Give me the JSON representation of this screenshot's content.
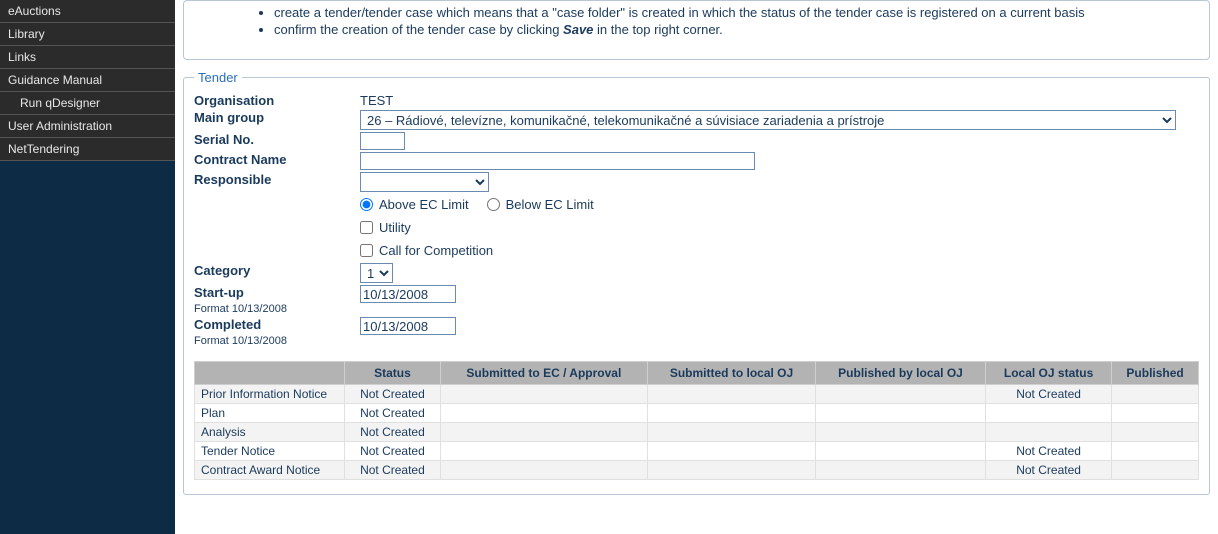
{
  "sidebar": {
    "items": [
      {
        "label": "eAuctions"
      },
      {
        "label": "Library"
      },
      {
        "label": "Links"
      },
      {
        "label": "Guidance Manual"
      },
      {
        "label": "Run qDesigner"
      },
      {
        "label": "User Administration"
      },
      {
        "label": "NetTendering"
      }
    ]
  },
  "intro": {
    "li1": "create a tender/tender case which means that a \"case folder\" is created in which the status of the tender case is registered on a current basis",
    "li2_a": "confirm the creation of the tender case by clicking ",
    "li2_b": "Save",
    "li2_c": " in the top right corner."
  },
  "tender": {
    "legend": "Tender",
    "labels": {
      "organisation": "Organisation",
      "maingroup": "Main group",
      "serial": "Serial No.",
      "contract": "Contract Name",
      "responsible": "Responsible",
      "above": "Above EC Limit",
      "below": "Below EC Limit",
      "utility": "Utility",
      "callcomp": "Call for Competition",
      "category": "Category",
      "startup": "Start-up",
      "completed": "Completed",
      "format": "Format 10/13/2008"
    },
    "values": {
      "organisation": "TEST",
      "maingroup": "26 – Rádiové, televízne, komunikačné, telekomunikačné a súvisiace zariadenia a prístroje",
      "serial": "",
      "contract": "",
      "responsible": "",
      "category": "1",
      "startup": "10/13/2008",
      "completed": "10/13/2008"
    }
  },
  "table": {
    "headers": [
      "",
      "Status",
      "Submitted to EC / Approval",
      "Submitted to local OJ",
      "Published by local OJ",
      "Local OJ status",
      "Published"
    ],
    "rows": [
      {
        "name": "Prior Information Notice",
        "status": "Not Created",
        "c3": "",
        "c4": "",
        "c5": "",
        "c6": "Not Created",
        "c7": ""
      },
      {
        "name": "Plan",
        "status": "Not Created",
        "c3": "",
        "c4": "",
        "c5": "",
        "c6": "",
        "c7": ""
      },
      {
        "name": "Analysis",
        "status": "Not Created",
        "c3": "",
        "c4": "",
        "c5": "",
        "c6": "",
        "c7": ""
      },
      {
        "name": "Tender Notice",
        "status": "Not Created",
        "c3": "",
        "c4": "",
        "c5": "",
        "c6": "Not Created",
        "c7": ""
      },
      {
        "name": "Contract Award Notice",
        "status": "Not Created",
        "c3": "",
        "c4": "",
        "c5": "",
        "c6": "Not Created",
        "c7": ""
      }
    ]
  }
}
